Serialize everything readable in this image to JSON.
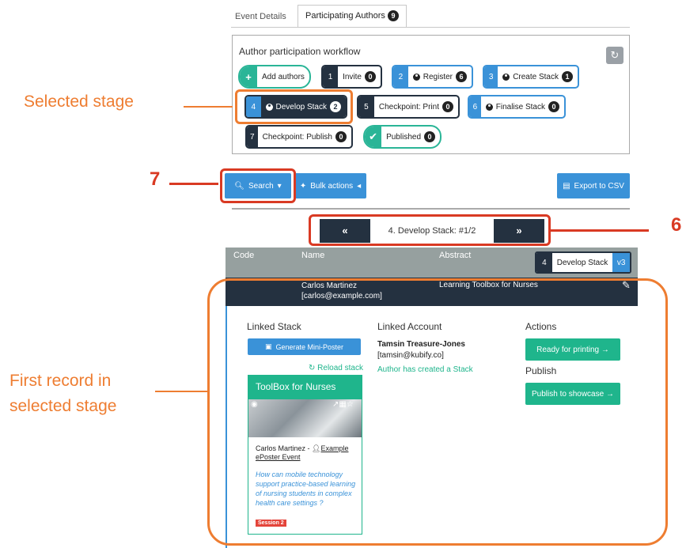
{
  "tabs": [
    {
      "label": "Event Details"
    },
    {
      "label": "Participating Authors",
      "count": "9"
    }
  ],
  "workflow": {
    "title": "Author participation workflow",
    "add_authors": "Add authors",
    "stages": [
      {
        "num": "1",
        "label": "Invite",
        "count": "0"
      },
      {
        "num": "2",
        "label": "Register",
        "count": "6"
      },
      {
        "num": "3",
        "label": "Create Stack",
        "count": "1"
      },
      {
        "num": "4",
        "label": "Develop Stack",
        "count": "2"
      },
      {
        "num": "5",
        "label": "Checkpoint: Print",
        "count": "0"
      },
      {
        "num": "6",
        "label": "Finalise Stack",
        "count": "0"
      },
      {
        "num": "7",
        "label": "Checkpoint: Publish",
        "count": "0"
      },
      {
        "num": "✔",
        "label": "Published",
        "count": "0"
      }
    ]
  },
  "toolbar": {
    "search": "Search",
    "bulk": "Bulk actions",
    "export": "Export to CSV"
  },
  "pager": {
    "prev": "«",
    "label": "4. Develop Stack:  #1/2",
    "next": "»"
  },
  "table": {
    "headers": [
      "Code",
      "Name",
      "Abstract"
    ],
    "stage_num": "4",
    "stage_label": "Develop Stack",
    "version": "v3"
  },
  "record": {
    "name": "Carlos Martinez",
    "email": "[carlos@example.com]",
    "abstract": "Learning Toolbox for Nurses"
  },
  "detail": {
    "linked_stack": "Linked Stack",
    "gen_poster": "Generate Mini-Poster",
    "reload": "Reload stack",
    "card_title": "ToolBox for Nurses",
    "card_author": "Carlos Martinez - ",
    "card_event": "Example ePoster Event",
    "card_abstract": "How can mobile technology support practice-based learning of nursing students in complex health care settings ?",
    "session": "Session 2",
    "linked_account": "Linked Account",
    "acc_name": "Tamsin Treasure-Jones",
    "acc_email": "[tamsin@kubify.co]",
    "acc_status": "Author has created a Stack",
    "actions": "Actions",
    "ready": "Ready for printing →",
    "publish": "Publish",
    "publish_btn": "Publish to showcase →"
  },
  "annotations": {
    "selected": "Selected stage",
    "first_record": "First record in selected stage",
    "n7": "7",
    "n6": "6"
  },
  "colors": {
    "navy": "#243140",
    "blue": "#3a92d8",
    "green": "#1fb58c",
    "orange": "#ee7d31",
    "red": "#d93a23"
  }
}
